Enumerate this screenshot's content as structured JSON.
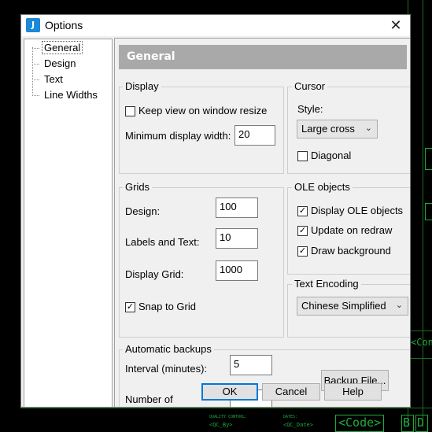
{
  "window": {
    "title": "Options",
    "app_icon": "jc-app-icon"
  },
  "tree": {
    "items": [
      {
        "label": "General",
        "selected": true
      },
      {
        "label": "Design"
      },
      {
        "label": "Text"
      },
      {
        "label": "Line Widths"
      }
    ]
  },
  "header": {
    "title": "General"
  },
  "display": {
    "title": "Display",
    "keep_view_label": "Keep view on window resize",
    "keep_view_checked": false,
    "min_width_label": "Minimum display width:",
    "min_width_value": "20"
  },
  "cursor": {
    "title": "Cursor",
    "style_label": "Style:",
    "style_value": "Large cross",
    "diagonal_label": "Diagonal",
    "diagonal_checked": false
  },
  "grids": {
    "title": "Grids",
    "design_label": "Design:",
    "design_value": "100",
    "labels_label": "Labels and Text:",
    "labels_value": "10",
    "display_grid_label": "Display Grid:",
    "display_grid_value": "1000",
    "snap_label": "Snap to Grid",
    "snap_checked": true
  },
  "ole": {
    "title": "OLE objects",
    "display_label": "Display OLE objects",
    "update_label": "Update on redraw",
    "draw_bg_label": "Draw background",
    "check_mark": "✓"
  },
  "encoding": {
    "title": "Text Encoding",
    "value": "Chinese Simplified"
  },
  "backups": {
    "title": "Automatic backups",
    "interval_label": "Interval (minutes):",
    "interval_value": "5",
    "number_label": "Number of",
    "backup_file_button": "Backup File..."
  },
  "buttons": {
    "ok": "OK",
    "cancel": "Cancel",
    "help": "Help"
  },
  "background": {
    "quality_control": "QUALITY CONTROL:",
    "qc_by": "<QC_By>",
    "dates": "DATES:",
    "qc_date": "<QC_Date>",
    "code": "<Code>",
    "con_partial": "<Con",
    "br_partial": "B",
    "d_partial": "D",
    "accent_color": "#1faa3a"
  }
}
